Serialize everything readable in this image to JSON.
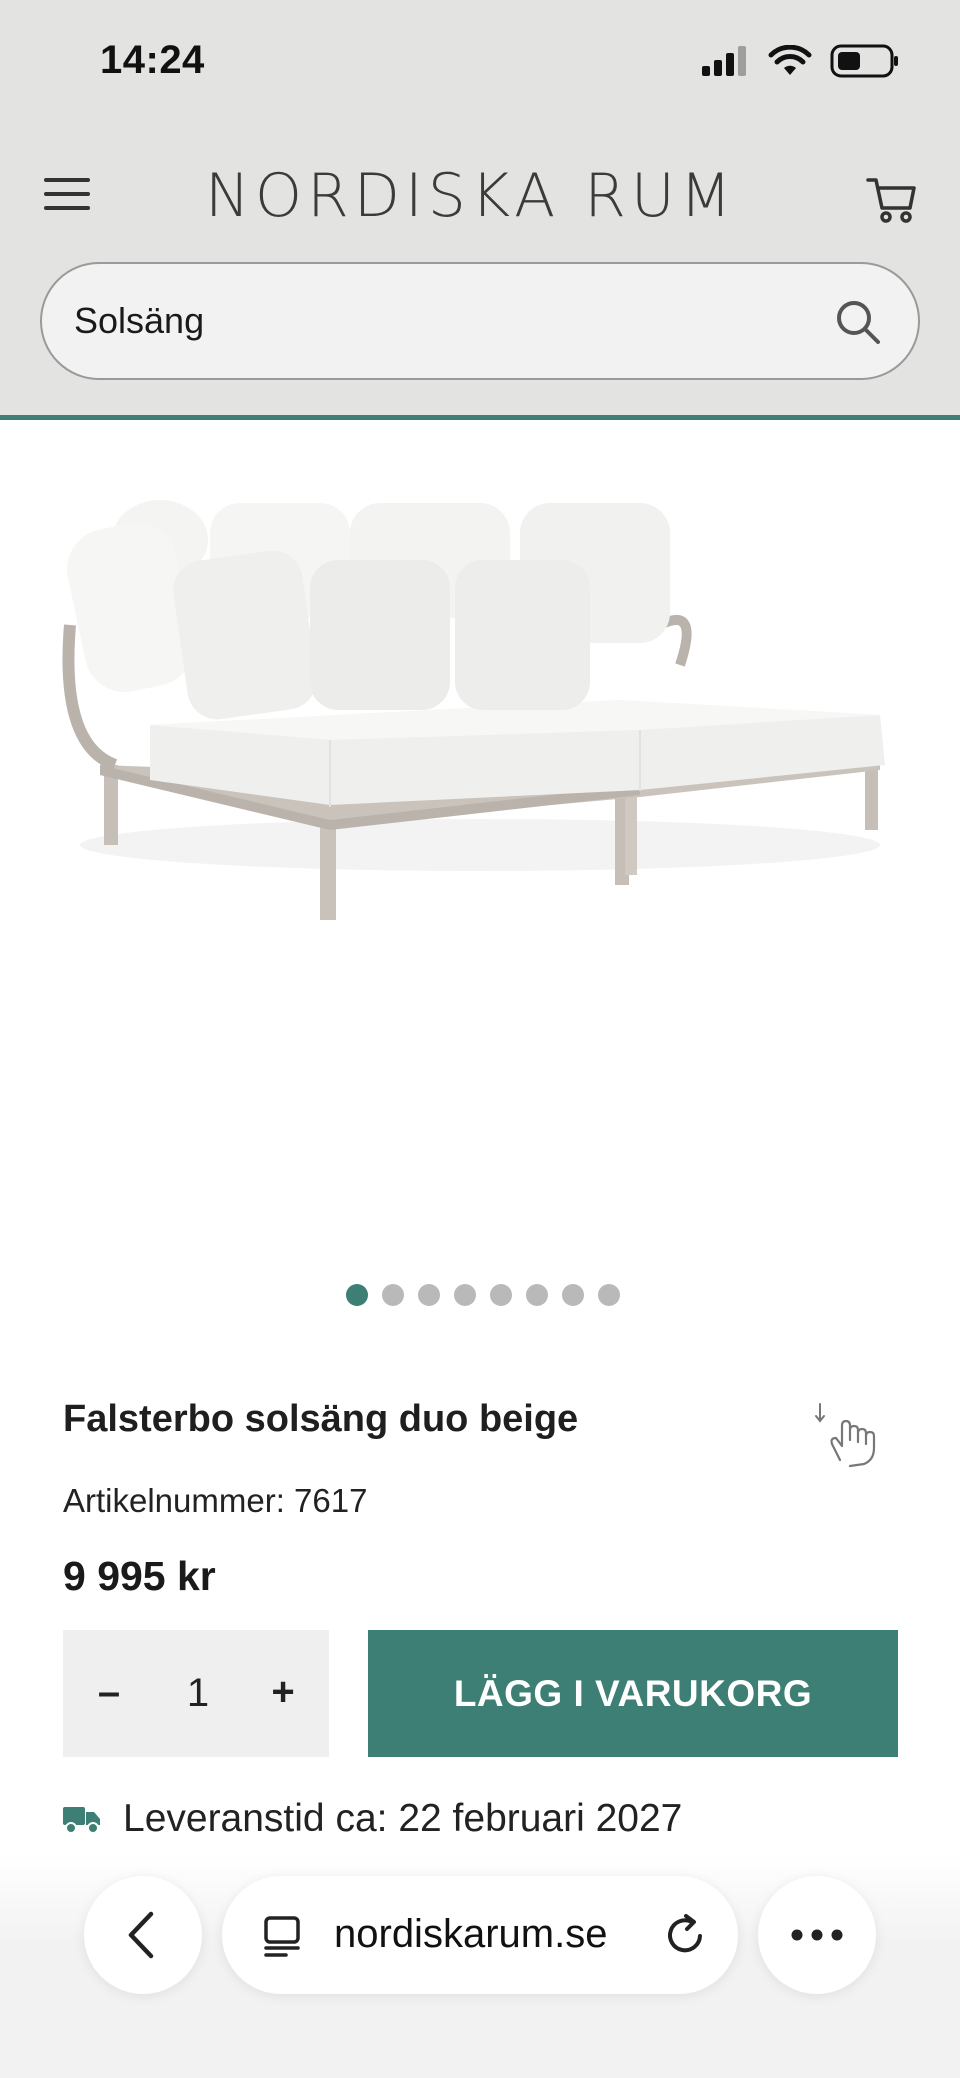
{
  "status_bar": {
    "time": "14:24",
    "icons": [
      "signal-icon",
      "wifi-icon",
      "battery-icon"
    ]
  },
  "header": {
    "menu_icon": "hamburger-menu-icon",
    "logo_text": "NORDISKA RUM",
    "cart_icon": "shopping-cart-icon"
  },
  "search": {
    "value": "Solsäng",
    "placeholder": "",
    "icon": "search-icon"
  },
  "gallery": {
    "image_alt": "Falsterbo solsäng duo beige",
    "dots_total": 8,
    "active_index": 0
  },
  "product": {
    "title": "Falsterbo solsäng duo beige",
    "article": "Artikelnummer: 7617",
    "price": "9 995 kr",
    "quantity": "1",
    "minus_label": "–",
    "plus_label": "+",
    "add_to_cart_label": "LÄGG I VARUKORG",
    "delivery_text": "Leveranstid ca: 22 februari 2027",
    "delivery_icon": "truck-icon",
    "zoom_icon": "pinch-zoom-hand-icon"
  },
  "browser": {
    "url": "nordiskarum.se",
    "back_icon": "chevron-left-icon",
    "tabs_icon": "tab-icon",
    "reload_icon": "reload-icon",
    "more_icon": "more-dots-icon"
  },
  "colors": {
    "accent": "#3d7f74",
    "header_bg": "#e3e3e2",
    "dot_inactive": "#b9b9b9"
  }
}
